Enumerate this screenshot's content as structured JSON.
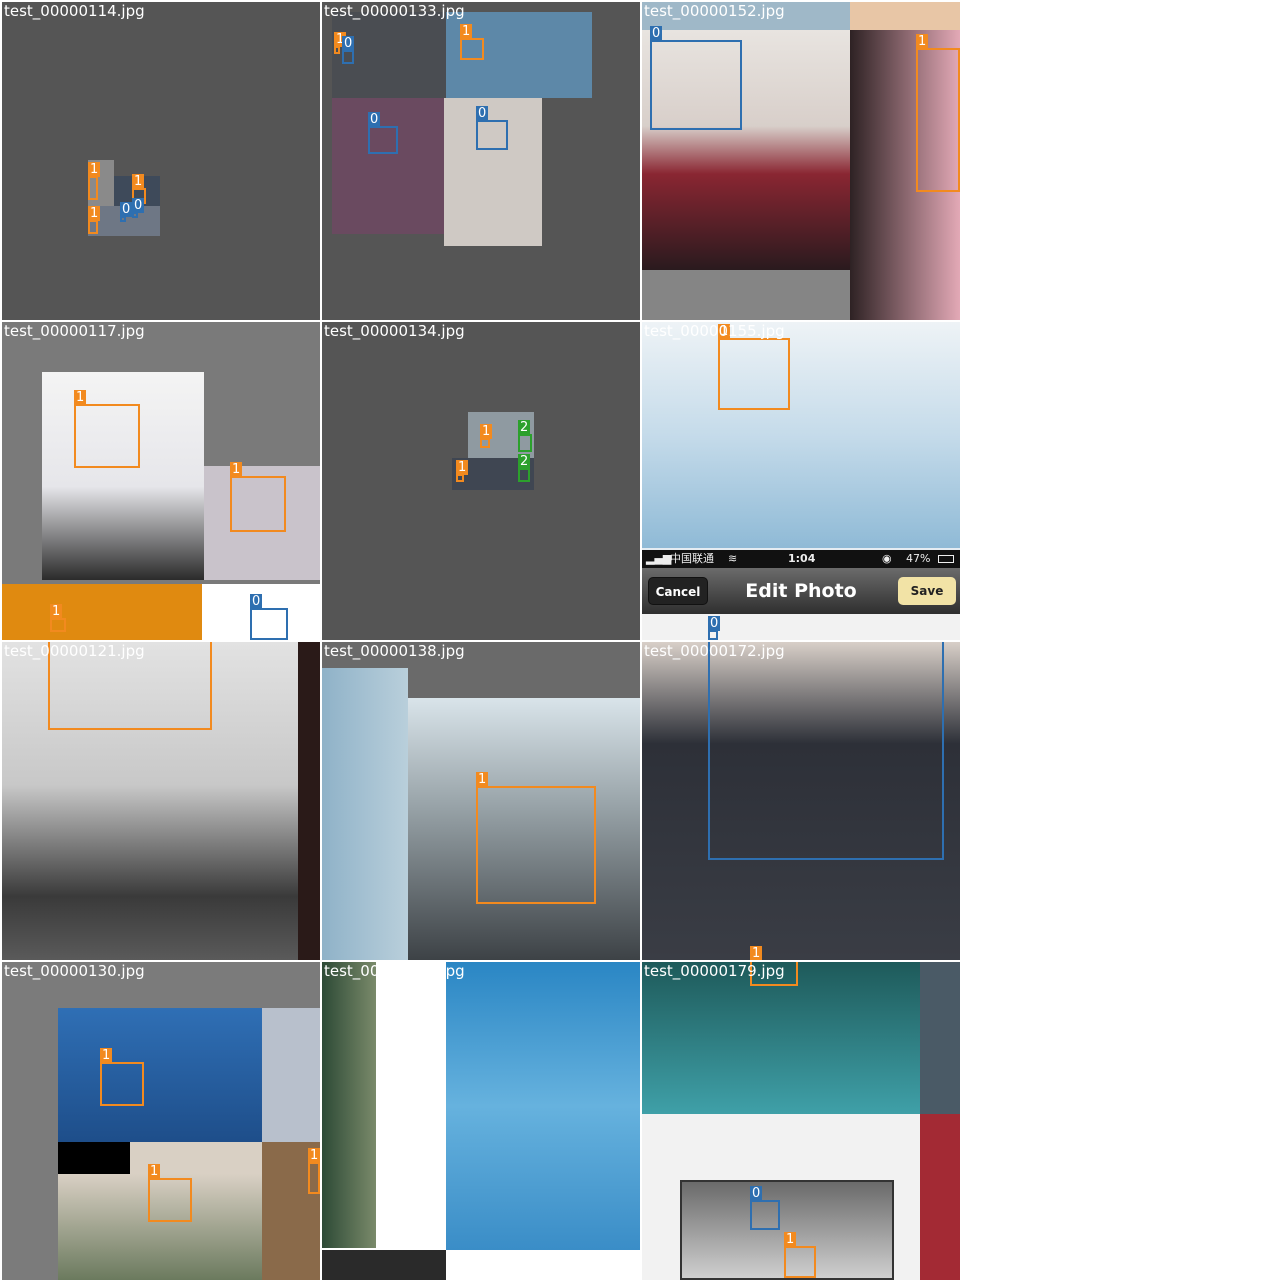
{
  "tiles": [
    {
      "filename": "test_00000114.jpg"
    },
    {
      "filename": "test_00000133.jpg"
    },
    {
      "filename": "test_00000152.jpg"
    },
    {
      "filename": "test_00000117.jpg"
    },
    {
      "filename": "test_00000134.jpg"
    },
    {
      "filename": "test_00000155.jpg"
    },
    {
      "filename": "test_00000121.jpg"
    },
    {
      "filename": "test_00000138.jpg"
    },
    {
      "filename": "test_00000172.jpg"
    },
    {
      "filename": "test_00000130.jpg"
    },
    {
      "filename": "test_00000143.jpg"
    },
    {
      "filename": "test_00000179.jpg"
    }
  ],
  "class_labels": {
    "c0": "0",
    "c1": "1",
    "c2": "2"
  },
  "class_colors": {
    "c0": "#2e6fb0",
    "c1": "#f28a1f",
    "c2": "#2ca02c"
  },
  "phone_ui": {
    "carrier": "中国联通",
    "time": "1:04",
    "battery": "47%",
    "cancel_label": "Cancel",
    "title": "Edit Photo",
    "save_label": "Save"
  }
}
